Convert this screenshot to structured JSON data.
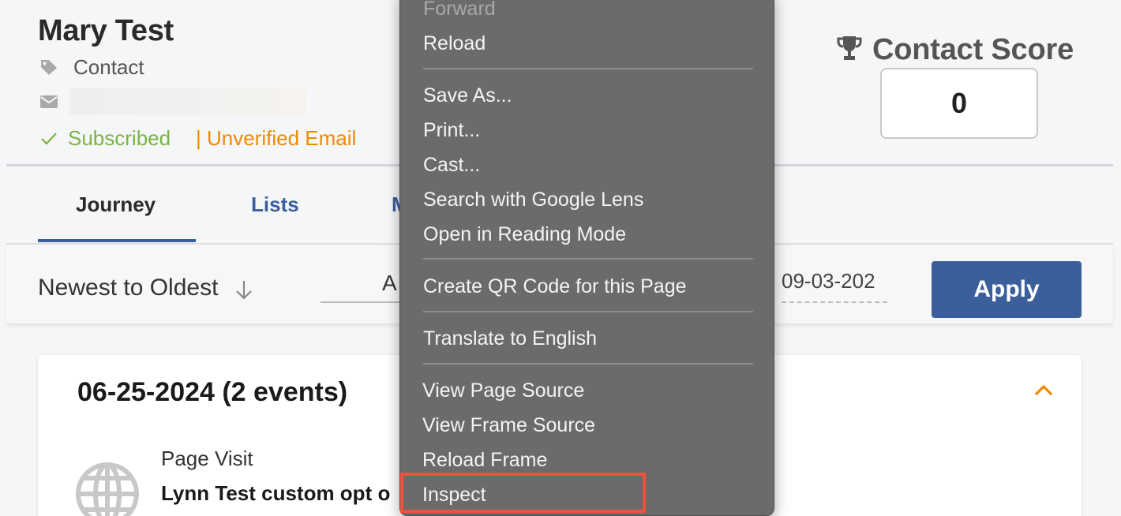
{
  "contact": {
    "name": "Mary Test",
    "type_label": "Contact",
    "subscription_status": "Subscribed",
    "email_status": "| Unverified Email"
  },
  "score": {
    "title": "Contact Score",
    "value": "0"
  },
  "tabs": [
    {
      "label": "Journey",
      "active": true
    },
    {
      "label": "Lists",
      "active": false
    },
    {
      "label": "M",
      "active": false
    }
  ],
  "filters": {
    "sort_label": "Newest to Oldest",
    "action_value": "A",
    "date_value": "09-03-202",
    "apply_label": "Apply"
  },
  "events": {
    "date_heading": "06-25-2024 (2 events)",
    "items": [
      {
        "type": "Page Visit",
        "description": "Lynn Test custom opt o"
      }
    ]
  },
  "context_menu": {
    "items": [
      {
        "label": "Forward",
        "disabled": true
      },
      {
        "label": "Reload"
      },
      {
        "label": "Save As..."
      },
      {
        "label": "Print..."
      },
      {
        "label": "Cast..."
      },
      {
        "label": "Search with Google Lens"
      },
      {
        "label": "Open in Reading Mode"
      },
      {
        "label": "Create QR Code for this Page"
      },
      {
        "label": "Translate to English"
      },
      {
        "label": "View Page Source"
      },
      {
        "label": "View Frame Source"
      },
      {
        "label": "Reload Frame"
      },
      {
        "label": "Inspect",
        "highlighted": true
      }
    ]
  },
  "colors": {
    "brand_blue": "#3a5f9b",
    "subscribed_green": "#7cb342",
    "warning_orange": "#ef8a00",
    "highlight_red": "#f0523f",
    "menu_bg": "#6b6b6a"
  },
  "icons": [
    "tag-icon",
    "mail-icon",
    "check-icon",
    "trophy-icon",
    "arrow-down-icon",
    "chevron-up-icon",
    "globe-icon"
  ]
}
